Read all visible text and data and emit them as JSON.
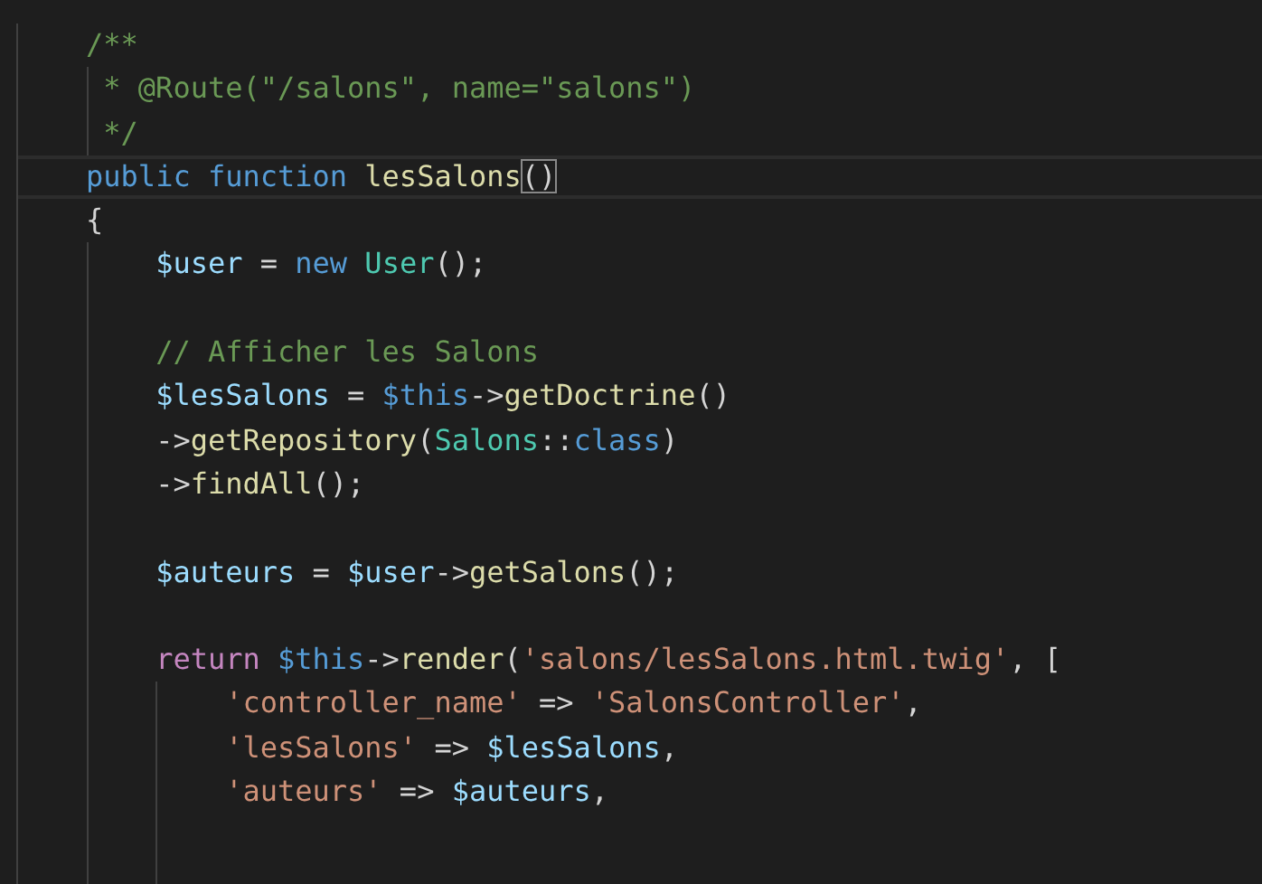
{
  "editor": {
    "lines": [
      {
        "kind": "code",
        "current": false,
        "tokens": [
          {
            "kind": "comment",
            "text": "/**"
          }
        ]
      },
      {
        "kind": "doc",
        "current": false,
        "tokens": [
          {
            "kind": "comment",
            "text": "* @Route(\"/salons\", name=\"salons\")"
          }
        ]
      },
      {
        "kind": "doc",
        "current": false,
        "tokens": [
          {
            "kind": "comment",
            "text": "*/"
          }
        ]
      },
      {
        "kind": "code",
        "current": true,
        "tokens": [
          {
            "kind": "keyword",
            "text": "public"
          },
          {
            "kind": "keyword",
            "text": " function"
          },
          {
            "kind": "function",
            "text": " lesSalons"
          },
          {
            "kind": "bracket-match",
            "text": "()"
          }
        ]
      },
      {
        "kind": "code",
        "current": false,
        "tokens": [
          {
            "kind": "plain",
            "text": "{"
          }
        ]
      },
      {
        "kind": "block",
        "children": [
          {
            "kind": "code",
            "current": false,
            "tokens": [
              {
                "kind": "variable",
                "text": "$user"
              },
              {
                "kind": "plain",
                "text": " = "
              },
              {
                "kind": "keyword",
                "text": "new"
              },
              {
                "kind": "class",
                "text": " User"
              },
              {
                "kind": "plain",
                "text": "();"
              }
            ]
          },
          {
            "kind": "blank",
            "current": false
          },
          {
            "kind": "code",
            "current": false,
            "tokens": [
              {
                "kind": "comment",
                "text": "// Afficher les Salons"
              }
            ]
          },
          {
            "kind": "code",
            "current": false,
            "tokens": [
              {
                "kind": "variable",
                "text": "$lesSalons"
              },
              {
                "kind": "plain",
                "text": " = "
              },
              {
                "kind": "keyword",
                "text": "$this"
              },
              {
                "kind": "plain",
                "text": "->"
              },
              {
                "kind": "function",
                "text": "getDoctrine"
              },
              {
                "kind": "plain",
                "text": "()"
              }
            ]
          },
          {
            "kind": "code",
            "current": false,
            "tokens": [
              {
                "kind": "plain",
                "text": "->"
              },
              {
                "kind": "function",
                "text": "getRepository"
              },
              {
                "kind": "plain",
                "text": "("
              },
              {
                "kind": "class",
                "text": "Salons"
              },
              {
                "kind": "plain",
                "text": "::"
              },
              {
                "kind": "keyword",
                "text": "class"
              },
              {
                "kind": "plain",
                "text": ")"
              }
            ]
          },
          {
            "kind": "code",
            "current": false,
            "tokens": [
              {
                "kind": "plain",
                "text": "->"
              },
              {
                "kind": "function",
                "text": "findAll"
              },
              {
                "kind": "plain",
                "text": "();"
              }
            ]
          },
          {
            "kind": "blank",
            "current": false
          },
          {
            "kind": "code",
            "current": false,
            "tokens": [
              {
                "kind": "variable",
                "text": "$auteurs"
              },
              {
                "kind": "plain",
                "text": " = "
              },
              {
                "kind": "variable",
                "text": "$user"
              },
              {
                "kind": "plain",
                "text": "->"
              },
              {
                "kind": "function",
                "text": "getSalons"
              },
              {
                "kind": "plain",
                "text": "();"
              }
            ]
          },
          {
            "kind": "blank",
            "current": false
          },
          {
            "kind": "code",
            "current": false,
            "tokens": [
              {
                "kind": "control",
                "text": "return"
              },
              {
                "kind": "keyword",
                "text": " $this"
              },
              {
                "kind": "plain",
                "text": "->"
              },
              {
                "kind": "function",
                "text": "render"
              },
              {
                "kind": "plain",
                "text": "("
              },
              {
                "kind": "string",
                "text": "'salons/lesSalons.html.twig'"
              },
              {
                "kind": "plain",
                "text": ", ["
              }
            ]
          },
          {
            "kind": "block",
            "children": [
              {
                "kind": "code",
                "current": false,
                "tokens": [
                  {
                    "kind": "string",
                    "text": "'controller_name'"
                  },
                  {
                    "kind": "plain",
                    "text": " => "
                  },
                  {
                    "kind": "string",
                    "text": "'SalonsController'"
                  },
                  {
                    "kind": "plain",
                    "text": ","
                  }
                ]
              },
              {
                "kind": "code",
                "current": false,
                "tokens": [
                  {
                    "kind": "string",
                    "text": "'lesSalons'"
                  },
                  {
                    "kind": "plain",
                    "text": " => "
                  },
                  {
                    "kind": "variable",
                    "text": "$lesSalons"
                  },
                  {
                    "kind": "plain",
                    "text": ","
                  }
                ]
              },
              {
                "kind": "code",
                "current": false,
                "tokens": [
                  {
                    "kind": "string",
                    "text": "'auteurs'"
                  },
                  {
                    "kind": "plain",
                    "text": " => "
                  },
                  {
                    "kind": "variable",
                    "text": "$auteurs"
                  },
                  {
                    "kind": "plain",
                    "text": ","
                  }
                ]
              },
              {
                "kind": "blank",
                "current": false
              },
              {
                "kind": "blank",
                "current": false
              }
            ]
          }
        ]
      }
    ]
  }
}
